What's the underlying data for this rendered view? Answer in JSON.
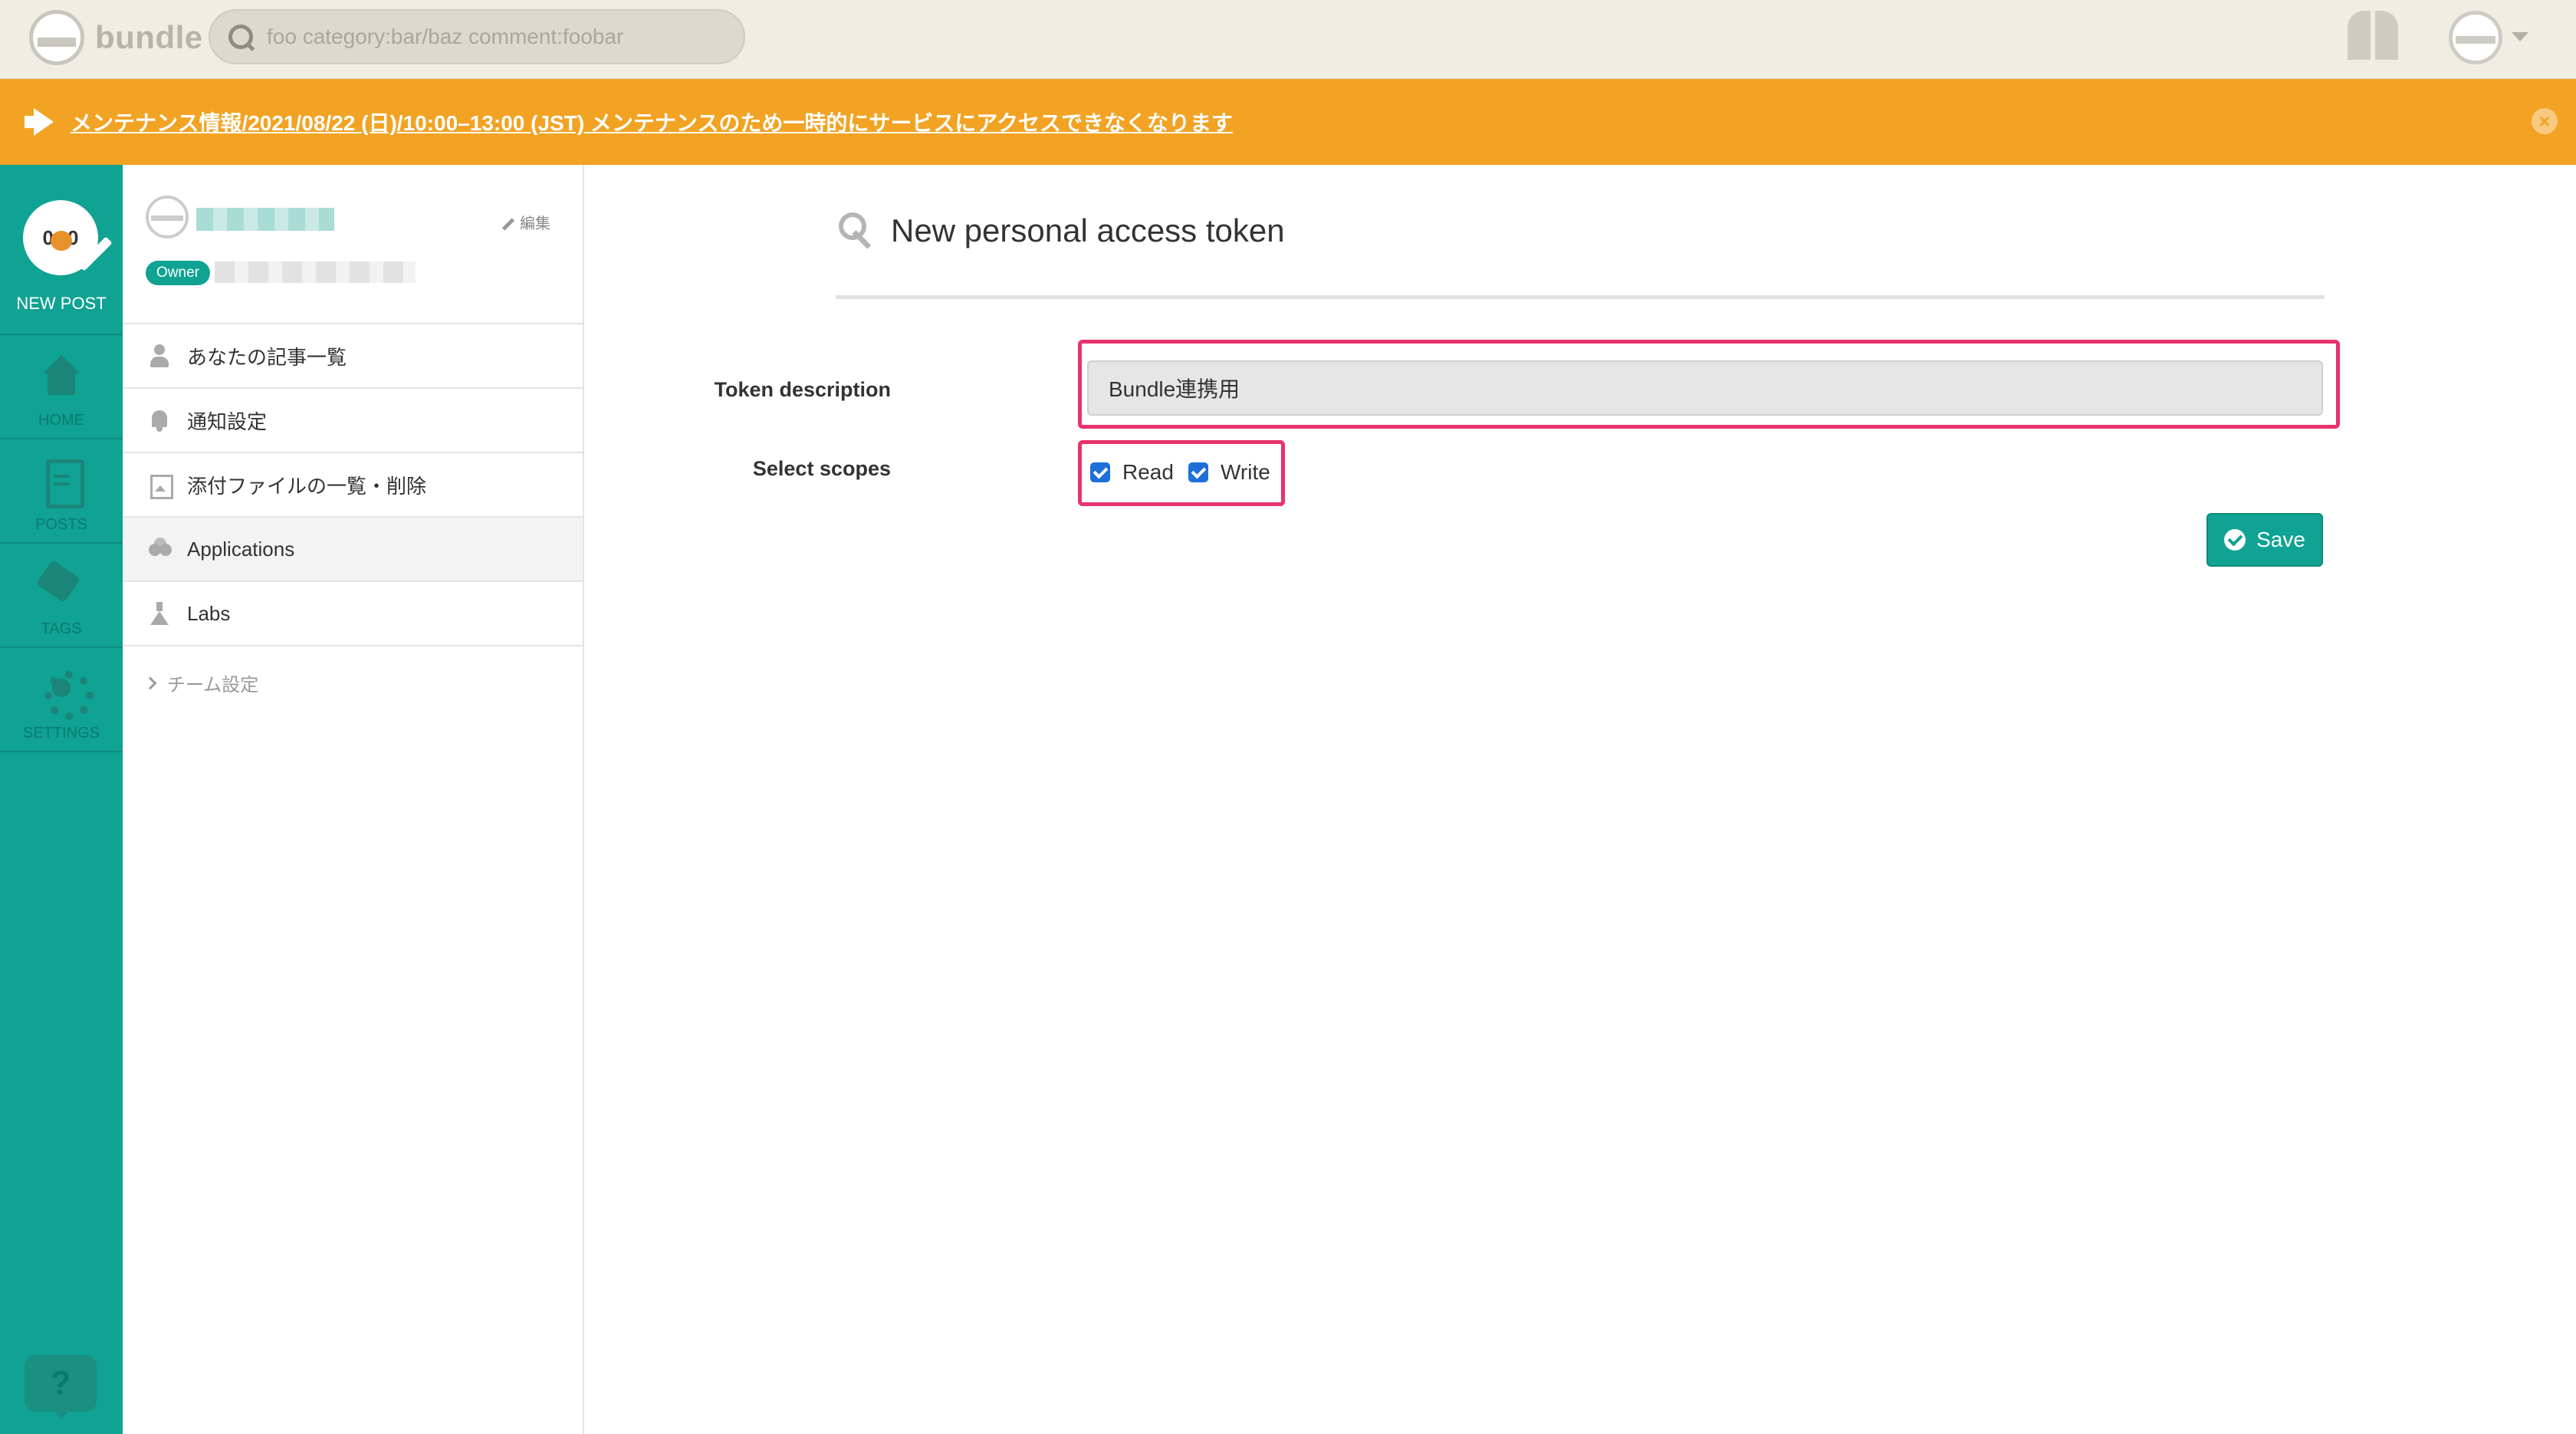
{
  "app": {
    "name": "bundle"
  },
  "search": {
    "placeholder": "foo category:bar/baz comment:foobar"
  },
  "banner": {
    "text": "メンテナンス情報/2021/08/22 (日)/10:00–13:00 (JST) メンテナンスのため一時的にサービスにアクセスできなくなります",
    "close": "×"
  },
  "rail": {
    "new_post": "NEW POST",
    "items": [
      {
        "label": "HOME",
        "icon": "home-icon"
      },
      {
        "label": "POSTS",
        "icon": "document-icon"
      },
      {
        "label": "TAGS",
        "icon": "tag-icon"
      },
      {
        "label": "SETTINGS",
        "icon": "gear-icon"
      }
    ],
    "help": "?"
  },
  "profile": {
    "edit": "編集",
    "role": "Owner"
  },
  "menu": {
    "items": [
      {
        "label": "あなたの記事一覧",
        "icon": "user-icon"
      },
      {
        "label": "通知設定",
        "icon": "bell-icon"
      },
      {
        "label": "添付ファイルの一覧・削除",
        "icon": "image-icon"
      },
      {
        "label": "Applications",
        "icon": "apps-icon",
        "active": true
      },
      {
        "label": "Labs",
        "icon": "flask-icon"
      }
    ],
    "team_settings": "チーム設定"
  },
  "main": {
    "title": "New personal access token",
    "token_label": "Token description",
    "token_value": "Bundle連携用",
    "scopes_label": "Select scopes",
    "scopes": [
      {
        "label": "Read",
        "checked": true
      },
      {
        "label": "Write",
        "checked": true
      }
    ],
    "save": "Save"
  },
  "colors": {
    "brand": "#10a293",
    "banner": "#f2a324",
    "highlight": "#e8336b",
    "checkbox": "#1e6fd9"
  }
}
